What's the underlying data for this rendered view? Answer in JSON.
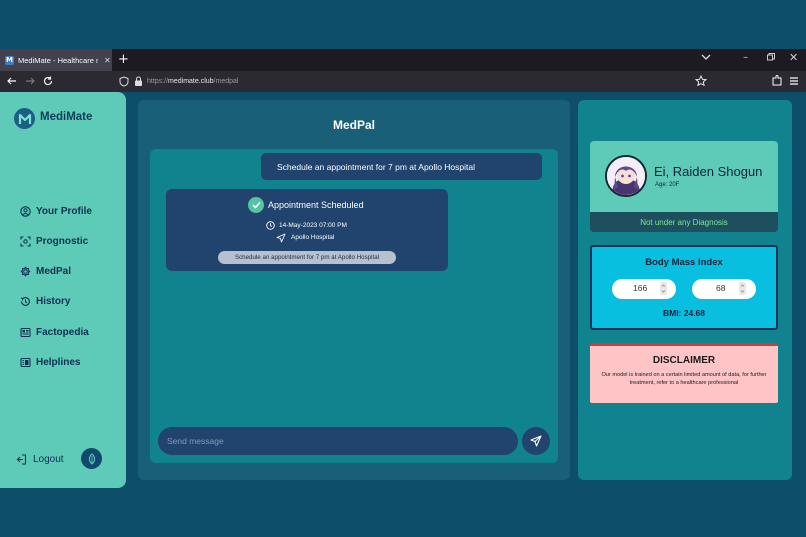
{
  "browser": {
    "tab_title": "MediMate - Healthcare made s",
    "url_prefix": "https://",
    "url_domain": "medimate.club",
    "url_path": "/medpal"
  },
  "sidebar": {
    "logo": "MediMate",
    "items": [
      {
        "label": "Your Profile",
        "icon": "user-circle-icon"
      },
      {
        "label": "Prognostic",
        "icon": "scan-icon"
      },
      {
        "label": "MedPal",
        "icon": "gear-icon"
      },
      {
        "label": "History",
        "icon": "history-icon"
      },
      {
        "label": "Factopedia",
        "icon": "newspaper-icon"
      },
      {
        "label": "Helplines",
        "icon": "phonebook-icon"
      }
    ],
    "logout": "Logout"
  },
  "chat": {
    "title": "MedPal",
    "user_message": "Schedule an appointment for 7 pm at Apollo Hospital",
    "card": {
      "title": "Appointment Scheduled",
      "datetime": "14-May-2023 07:00 PM",
      "location": "Apollo Hospital",
      "chip": "Schedule an appointment for 7 pm at Apollo Hospital"
    },
    "input_placeholder": "Send message"
  },
  "profile": {
    "name": "Ei, Raiden Shogun",
    "age": "Age: 20F",
    "diagnosis": "Not under any Diagnosis"
  },
  "bmi": {
    "title": "Body Mass Index",
    "height": "166",
    "weight": "68",
    "result": "BMI: 24.68"
  },
  "disclaimer": {
    "title": "DISCLAIMER",
    "text": "Our model is trained on a certain limited amount of data, for further treatment, refer to a healthcare professional"
  },
  "colors": {
    "sidebar": "#5ecab8",
    "panel": "#1a5f78",
    "accent": "#11838f",
    "bubble": "#21446e",
    "bmi_card": "#09bfe0",
    "disclaimer_bg": "#ffc4c6"
  }
}
